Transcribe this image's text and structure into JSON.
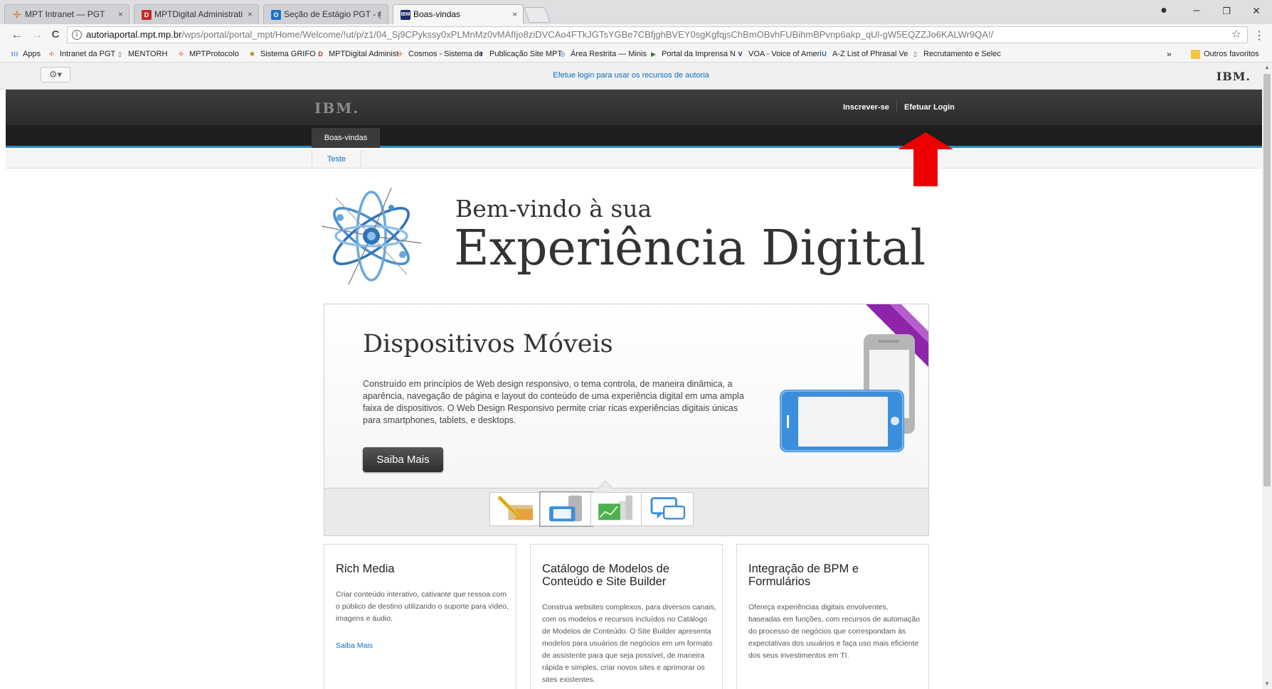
{
  "browser": {
    "tabs": [
      {
        "title": "MPT Intranet — PGT",
        "icon_color": "#e06b1f",
        "icon": "mpt-logo-icon"
      },
      {
        "title": "MPTDigital Administrati",
        "icon_color": "#c62828",
        "icon": "mpt-digital-icon"
      },
      {
        "title": "Seção de Estágio PGT - (",
        "icon_color": "#1e70c8",
        "icon": "outlook-icon"
      },
      {
        "title": "Boas-vindas",
        "icon_color": "#1a2a6c",
        "icon": "ibm-icon"
      }
    ],
    "favicon_ibm_text": "IBM",
    "favicon_outlook_text": "O",
    "favicon_mpt_text": "D",
    "tab_close": "×",
    "url_host": "autoriaportal.mpt.mp.br",
    "url_path": "/wps/portal/portal_mpt/Home/Welcome/!ut/p/z1/04_Sj9CPykssy0xPLMnMz0vMAfIjo8ziDVCAo4FTkJGTsYGBe7CBfjghBVEY0sgKgfqjsChBmOBvhFUBihmBPvnp6akp_qUl-gW5EQZZJo6KALWr9QA!/",
    "info_glyph": "i",
    "star_glyph": "☆",
    "menu_glyph": "⋮",
    "window": {
      "account": "●",
      "minimize": "–",
      "restore": "❐",
      "close": "✕"
    },
    "nav": {
      "back": "←",
      "forward": "→",
      "reload": "C"
    }
  },
  "bookmarks": [
    {
      "label": "Apps",
      "icon": "apps-grid-icon",
      "color": "#4285f4",
      "glyph": "⁝⁝⁝"
    },
    {
      "label": "Intranet da PGT",
      "icon": "mpt-logo-icon",
      "color": "#e06b1f",
      "glyph": "✢"
    },
    {
      "label": "MENTORH",
      "icon": "page-icon",
      "color": "#666666",
      "glyph": "▯"
    },
    {
      "label": "MPTProtocolo",
      "icon": "mpt-logo-icon",
      "color": "#e06b1f",
      "glyph": "✢"
    },
    {
      "label": "Sistema GRIFO",
      "icon": "grifo-icon",
      "color": "#b8860b",
      "glyph": "✱"
    },
    {
      "label": "MPTDigital Administ",
      "icon": "mpt-digital-icon",
      "color": "#c62828",
      "glyph": "D"
    },
    {
      "label": "Cosmos - Sistema de",
      "icon": "mpt-logo-icon",
      "color": "#e06b1f",
      "glyph": "✢"
    },
    {
      "label": "Publicação Site MPT",
      "icon": "ibm-icon",
      "color": "#1a2a6c",
      "glyph": "I"
    },
    {
      "label": "Área Restrita — Minis",
      "icon": "gov-icon",
      "color": "#1e70c8",
      "glyph": "◎"
    },
    {
      "label": "Portal da Imprensa N",
      "icon": "portal-icon",
      "color": "#2e7d32",
      "glyph": "▶"
    },
    {
      "label": "VOA - Voice of Ameri",
      "icon": "voa-icon",
      "color": "#1a237e",
      "glyph": "V"
    },
    {
      "label": "A-Z List of Phrasal Ve",
      "icon": "ue-icon",
      "color": "#1565c0",
      "glyph": "U"
    },
    {
      "label": "Recrutamento e Selec",
      "icon": "page-icon",
      "color": "#666666",
      "glyph": "▯"
    }
  ],
  "bookmarks_overflow": "»",
  "bookmarks_other": "Outros favoritos",
  "portal": {
    "site_menu_glyph": "⚙▾",
    "login_hint": "Efetue login para usar os recursos de autoria",
    "brand_mini": "IBM.",
    "brand_header": "IBM.",
    "register": "Inscrever-se",
    "login": "Efetuar Login",
    "nav_tab": "Boas-vindas",
    "subnav_item": "Teste",
    "accent": "#2d8ac7",
    "link_color": "#0d6fbd"
  },
  "hero": {
    "line1": "Bem-vindo à sua",
    "line2": "Experiência Digital"
  },
  "carousel": {
    "title": "Dispositivos Móveis",
    "text": "Construído em princípios de Web design responsivo, o tema controla, de maneira dinâmica, a aparência, navegação de página e layout do conteúdo de uma experiência digital em uma ampla faixa de dispositivos. O Web Design Responsivo permite criar ricas experiências digitais únicas para smartphones, tablets, e desktops.",
    "button": "Saiba Mais",
    "ribbon_color": "#8e24aa",
    "thumbs": [
      "tools-thumb-icon",
      "devices-thumb-icon",
      "chart-thumb-icon",
      "chat-thumb-icon"
    ],
    "active_thumb": 1
  },
  "cards": [
    {
      "title": "Rich Media",
      "text": "Criar conteúdo interativo, cativante que ressoa com o público de destino utilizando o suporte para vídeo, imagens e áudio.",
      "link": "Saiba Mais"
    },
    {
      "title": "Catálogo de Modelos de Conteúdo e Site Builder",
      "text": "Construa websites complexos, para diversos canais, com os modelos e recursos incluídos no Catálogo de Modelos de Conteúdo. O Site Builder apresenta modelos para usuários de negócios em um formato de assistente para que seja possível, de maneira rápida e simples, criar novos sites e aprimorar os sites existentes."
    },
    {
      "title": "Integração de BPM e Formulários",
      "text": "Ofereça experiências digitais envolventes, baseadas em funções, com recursos de automação do processo de negócios que correspondam às expectativas dos usuários e faça uso mais eficiente dos seus investimentos em TI."
    }
  ],
  "annotation_color": "#ee0000"
}
